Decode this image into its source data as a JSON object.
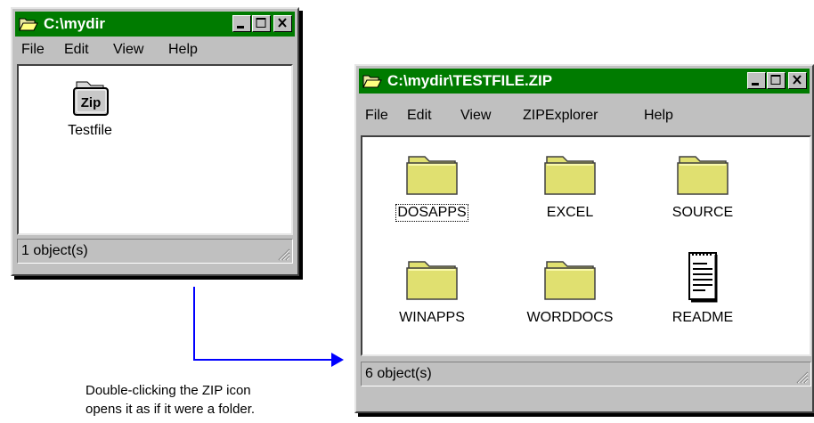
{
  "window1": {
    "title": "C:\\mydir",
    "menu": {
      "file": "File",
      "edit": "Edit",
      "view": "View",
      "help": "Help"
    },
    "items": [
      {
        "label": "Testfile",
        "badge": "Zip",
        "icon": "zip-file-icon"
      }
    ],
    "status": "1 object(s)"
  },
  "window2": {
    "title": "C:\\mydir\\TESTFILE.ZIP",
    "menu": {
      "file": "File",
      "edit": "Edit",
      "view": "View",
      "zipexplorer": "ZIPExplorer",
      "help": "Help"
    },
    "items": [
      {
        "label": "DOSAPPS",
        "icon": "folder-icon",
        "selected": true
      },
      {
        "label": "EXCEL",
        "icon": "folder-icon"
      },
      {
        "label": "SOURCE",
        "icon": "folder-icon"
      },
      {
        "label": "WINAPPS",
        "icon": "folder-icon"
      },
      {
        "label": "WORDDOCS",
        "icon": "folder-icon"
      },
      {
        "label": "README",
        "icon": "text-document-icon"
      }
    ],
    "status": "6 object(s)"
  },
  "caption": {
    "line1": "Double-clicking the ZIP icon",
    "line2": "opens it as if it were a folder."
  },
  "colors": {
    "titlebar": "#007b00",
    "arrow": "#0000ff",
    "folder": "#e0e070"
  }
}
